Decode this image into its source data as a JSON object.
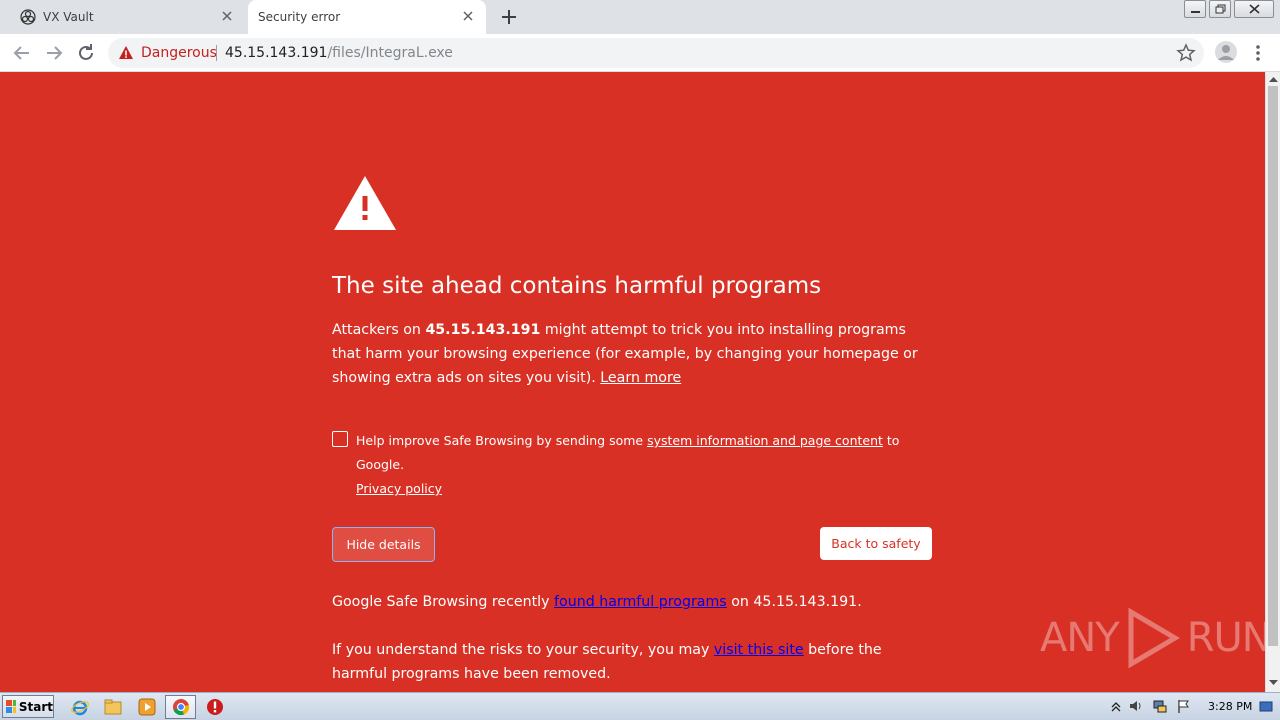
{
  "browser": {
    "tabs": [
      {
        "title": "VX Vault",
        "active": false
      },
      {
        "title": "Security error",
        "active": true
      }
    ],
    "omnibox": {
      "security_label": "Dangerous",
      "host": "45.15.143.191",
      "path": "/files/IntegraL.exe"
    }
  },
  "interstitial": {
    "heading": "The site ahead contains harmful programs",
    "para_part1": "Attackers on ",
    "para_host": "45.15.143.191",
    "para_part2": " might attempt to trick you into installing programs that harm your browsing experience (for example, by changing your homepage or showing extra ads on sites you visit). ",
    "learn_more": "Learn more",
    "opt_in_part1": "Help improve Safe Browsing by sending some ",
    "opt_in_link": "system information and page content",
    "opt_in_part2": " to Google.",
    "privacy_policy": "Privacy policy",
    "opt_in_checked": false,
    "hide_details_label": "Hide details",
    "back_to_safety_label": "Back to safety",
    "details_part1": "Google Safe Browsing recently ",
    "details_link": "found harmful programs",
    "details_part2": " on 45.15.143.191.",
    "risk_part1": "If you understand the risks to your security, you may ",
    "risk_link": "visit this site",
    "risk_part2": " before the harmful programs have been removed."
  },
  "watermark": {
    "left": "ANY",
    "right": "RUN"
  },
  "taskbar": {
    "start_label": "Start",
    "clock": "3:28 PM"
  },
  "colors": {
    "danger_red": "#d93025",
    "omnibox_bg": "#f1f3f4"
  }
}
